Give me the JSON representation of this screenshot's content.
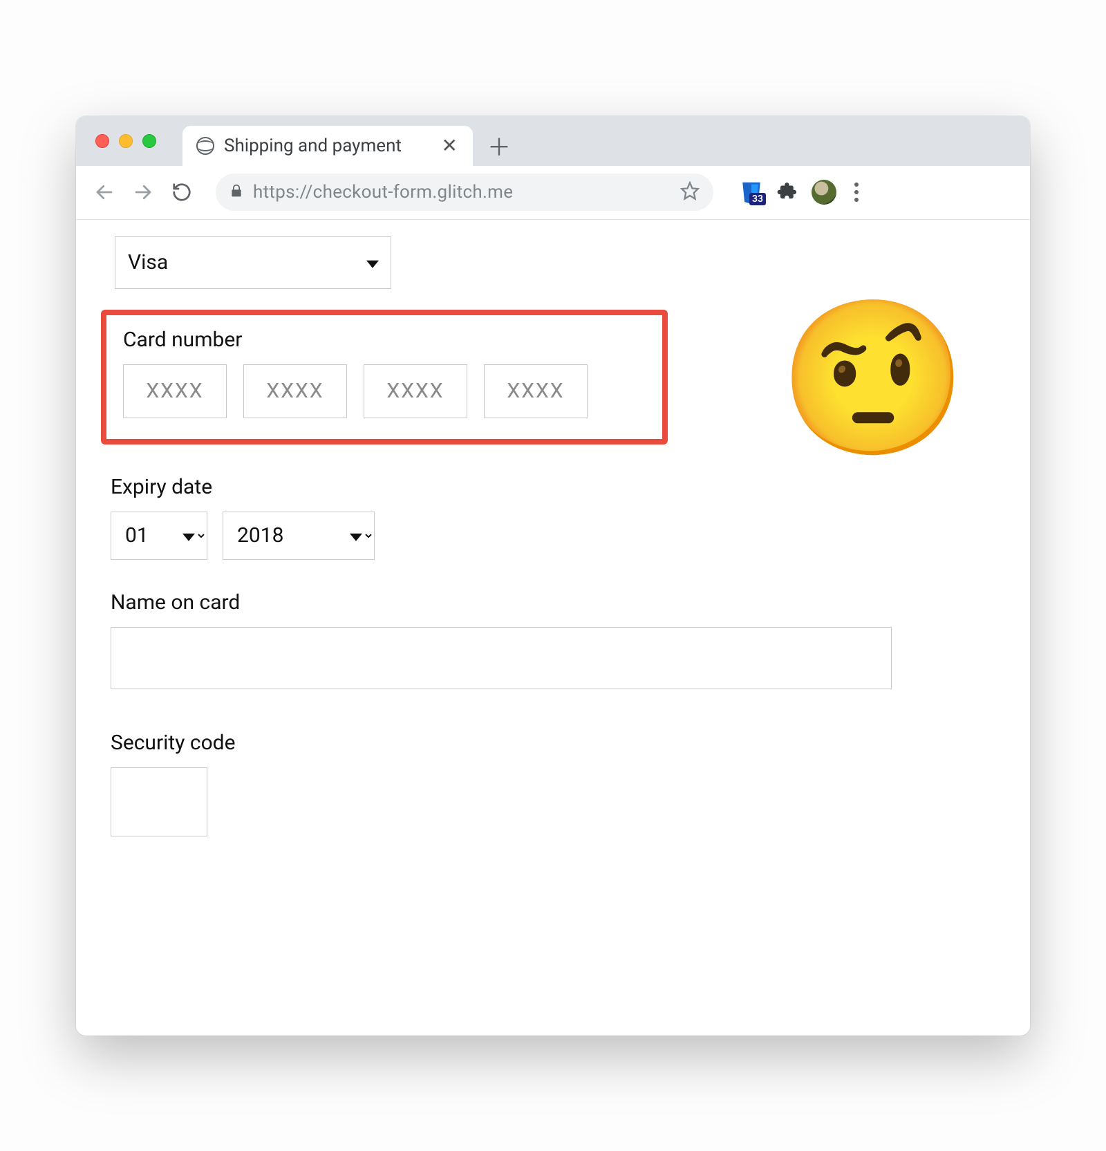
{
  "window": {
    "tab_title": "Shipping and payment",
    "url": "https://checkout-form.glitch.me",
    "extension_badge": "33"
  },
  "form": {
    "card_type": {
      "value": "Visa"
    },
    "card_number": {
      "label": "Card number",
      "placeholders": [
        "XXXX",
        "XXXX",
        "XXXX",
        "XXXX"
      ]
    },
    "expiry": {
      "label": "Expiry date",
      "month": "01",
      "year": "2018"
    },
    "name": {
      "label": "Name on card",
      "value": ""
    },
    "cvc": {
      "label": "Security code",
      "value": ""
    }
  },
  "emoji": "🤨"
}
